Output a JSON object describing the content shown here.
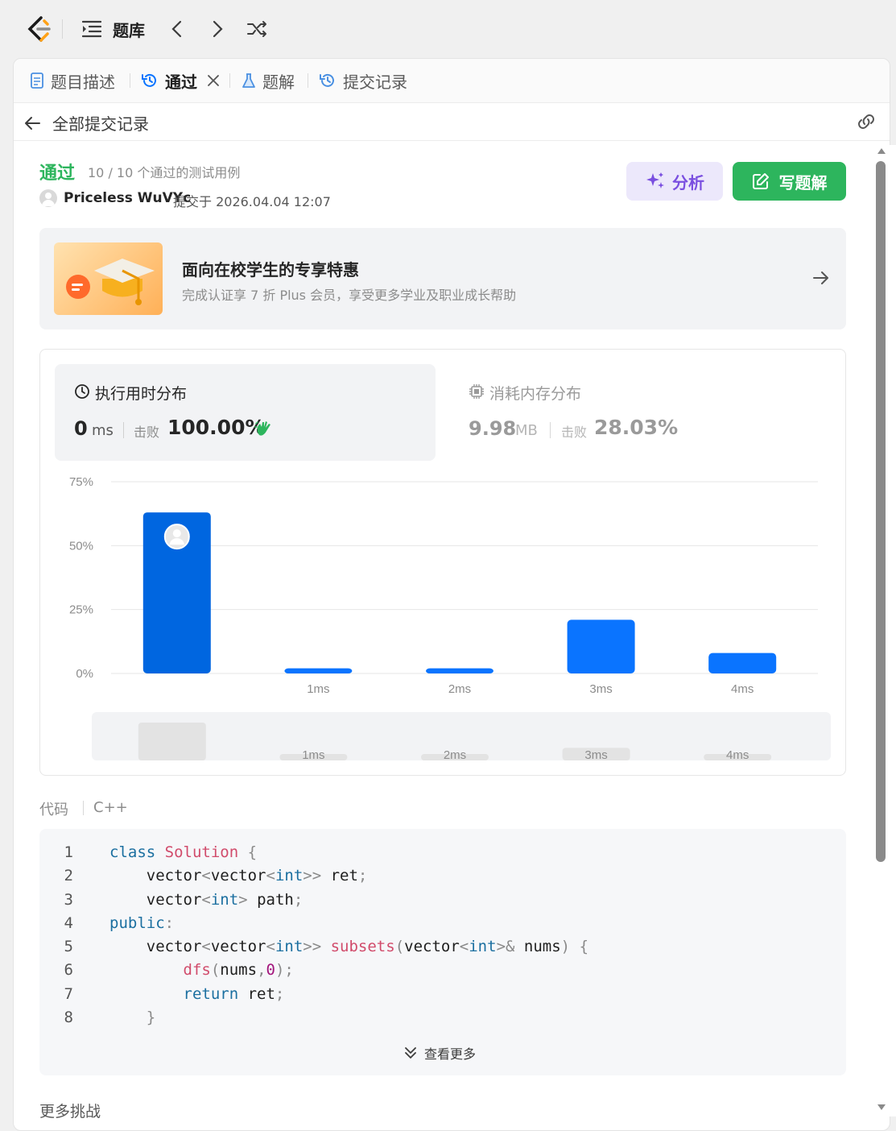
{
  "topbar": {
    "library_label": "题库"
  },
  "tabs": [
    {
      "label": "题目描述"
    },
    {
      "label": "通过"
    },
    {
      "label": "题解"
    },
    {
      "label": "提交记录"
    }
  ],
  "subheader": {
    "back_label": "全部提交记录"
  },
  "result": {
    "status": "通过",
    "cases": "10 / 10 个通过的测试用例",
    "user": "Priceless WuVYc",
    "submitted": "提交于 2026.04.04 12:07",
    "analyze_label": "分析",
    "write_solution_label": "写题解"
  },
  "promo": {
    "title": "面向在校学生的专享特惠",
    "subtitle": "完成认证享 7 折 Plus 会员，享受更多学业及职业成长帮助"
  },
  "stats": {
    "runtime_title": "执行用时分布",
    "runtime_value": "0",
    "runtime_unit": "ms",
    "beats_label": "击败",
    "runtime_beats": "100.00%",
    "memory_title": "消耗内存分布",
    "memory_value": "9.98",
    "memory_unit": "MB",
    "memory_beats": "28.03%"
  },
  "chart_data": {
    "type": "bar",
    "categories": [
      "",
      "1ms",
      "2ms",
      "3ms",
      "4ms"
    ],
    "values": [
      63,
      2,
      2,
      21,
      8
    ],
    "y_ticks": [
      "0%",
      "25%",
      "50%",
      "75%"
    ],
    "ylim": [
      0,
      75
    ],
    "highlight_index": 0,
    "bar_color": "#0a74ff",
    "highlight_color": "#0066e0",
    "grid": true
  },
  "code": {
    "label": "代码",
    "language": "C++",
    "lines": [
      "1",
      "2",
      "3",
      "4",
      "5",
      "6",
      "7",
      "8"
    ],
    "show_more": "查看更多"
  },
  "more_challenges": "更多挑战",
  "colors": {
    "accent_green": "#2db55d",
    "blue": "#0a74ff",
    "analyze_bg": "#ece8fb",
    "analyze_fg": "#7a4fe0"
  }
}
